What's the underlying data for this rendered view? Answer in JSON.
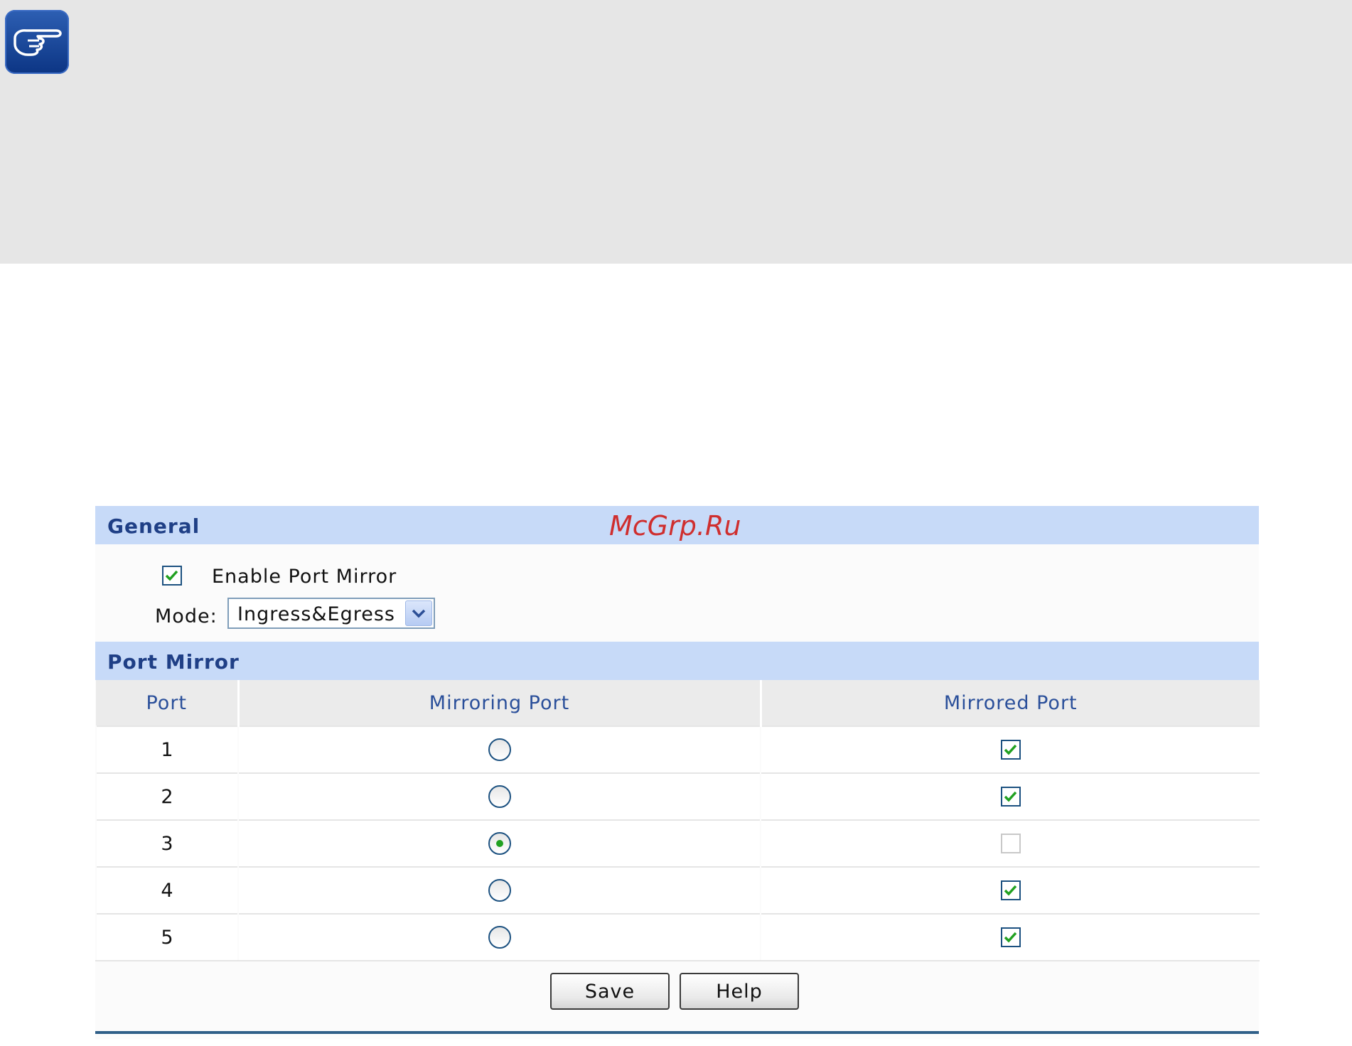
{
  "general": {
    "title": "General",
    "watermark": "McGrp.Ru",
    "enable_label": "Enable Port Mirror",
    "enable_checked": true,
    "mode_label": "Mode:",
    "mode_value": "Ingress&Egress"
  },
  "port_mirror": {
    "title": "Port Mirror",
    "columns": [
      "Port",
      "Mirroring Port",
      "Mirrored Port"
    ],
    "rows": [
      {
        "port": "1",
        "mirroring": false,
        "mirrored": true
      },
      {
        "port": "2",
        "mirroring": false,
        "mirrored": true
      },
      {
        "port": "3",
        "mirroring": true,
        "mirrored": false
      },
      {
        "port": "4",
        "mirroring": false,
        "mirrored": true
      },
      {
        "port": "5",
        "mirroring": false,
        "mirrored": true
      }
    ]
  },
  "buttons": {
    "save_label": "Save",
    "help_label": "Help"
  },
  "colors": {
    "header_bg": "#c7daf8",
    "header_text": "#1f3f86",
    "check_green": "#21a121"
  },
  "icons": {
    "note": "pointing-hand-icon"
  }
}
